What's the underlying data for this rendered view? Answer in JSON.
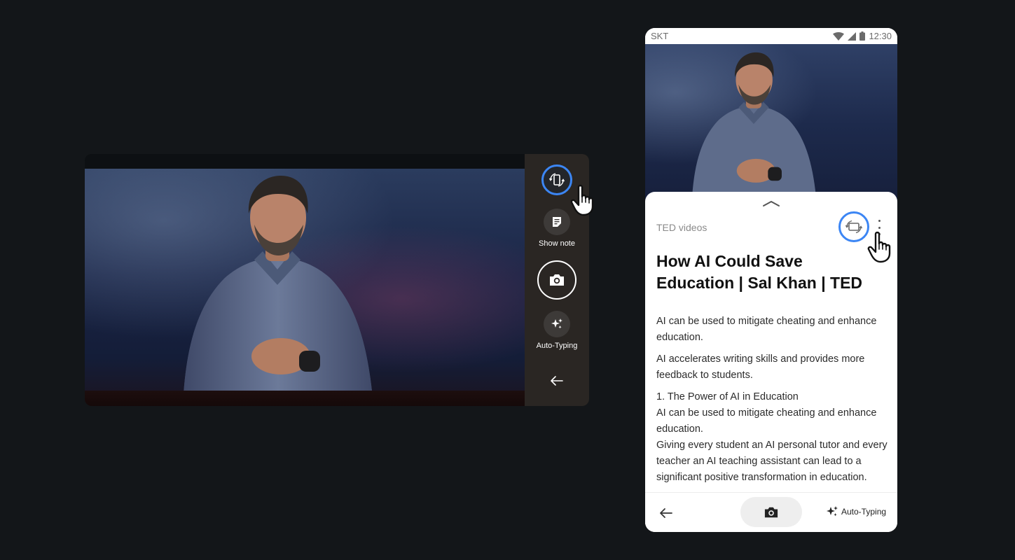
{
  "landscape": {
    "side_panel": {
      "show_note_label": "Show note",
      "auto_typing_label": "Auto-Typing"
    }
  },
  "phone": {
    "status": {
      "carrier": "SKT",
      "time": "12:30"
    },
    "source": "TED videos",
    "title": "How AI Could Save Education | Sal Khan | TED",
    "paragraphs": [
      "AI can be used to mitigate cheating and enhance education.",
      "AI accelerates writing skills and provides more feedback to students."
    ],
    "section_heading": "1. The Power of AI in Education",
    "section_lines": [
      "AI can be used to mitigate cheating and enhance education.",
      "Giving every student an AI personal tutor and every teacher an AI teaching assistant can lead to a significant positive transformation in education."
    ],
    "bottom_bar": {
      "auto_typing_label": "Auto-Typing"
    }
  },
  "colors": {
    "accent": "#3c86f4",
    "background": "#131619",
    "side_panel": "#2a2623"
  },
  "icons": [
    "rotate-screen-icon",
    "note-icon",
    "camera-icon",
    "sparkle-icon",
    "back-arrow-icon",
    "pointer-hand-icon",
    "wifi-icon",
    "signal-icon",
    "battery-icon",
    "chevron-up-icon",
    "more-vert-icon"
  ]
}
